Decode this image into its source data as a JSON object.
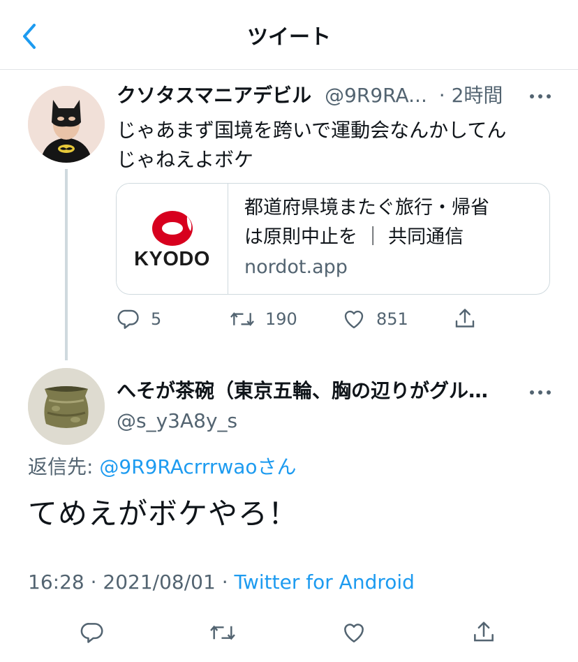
{
  "header": {
    "title": "ツイート"
  },
  "tweet1": {
    "display_name": "クソタスマニアデビル",
    "handle": "@9R9RA...",
    "time": "· 2時間",
    "text_line1": "じゃあまず国境を跨いで運動会なんかしてん",
    "text_line2": "じゃねえよボケ",
    "card": {
      "logo_text": "KYODO",
      "title_line1": "都道府県境またぐ旅行・帰省",
      "title_line2": "は原則中止を ｜ 共同通信",
      "domain": "nordot.app"
    },
    "actions": {
      "replies": "5",
      "retweets": "190",
      "likes": "851"
    }
  },
  "tweet2": {
    "display_name": "へそが茶碗（東京五輪、胸の辺りがグル…",
    "handle": "@s_y3A8y_s",
    "reply_prefix": "返信先: ",
    "reply_handle": "@9R9RAcrrrwao",
    "reply_suffix": "さん",
    "text": "てめえがボケやろ！",
    "time": "16:28",
    "date": "2021/08/01",
    "source": "Twitter for Android"
  },
  "colors": {
    "link": "#1d9bf0",
    "secondary": "#536471",
    "border": "#cfd9de",
    "kyodo_red": "#d7001e"
  },
  "icons": [
    "back-arrow-icon",
    "more-icon",
    "reply-icon",
    "retweet-icon",
    "like-icon",
    "share-icon"
  ]
}
